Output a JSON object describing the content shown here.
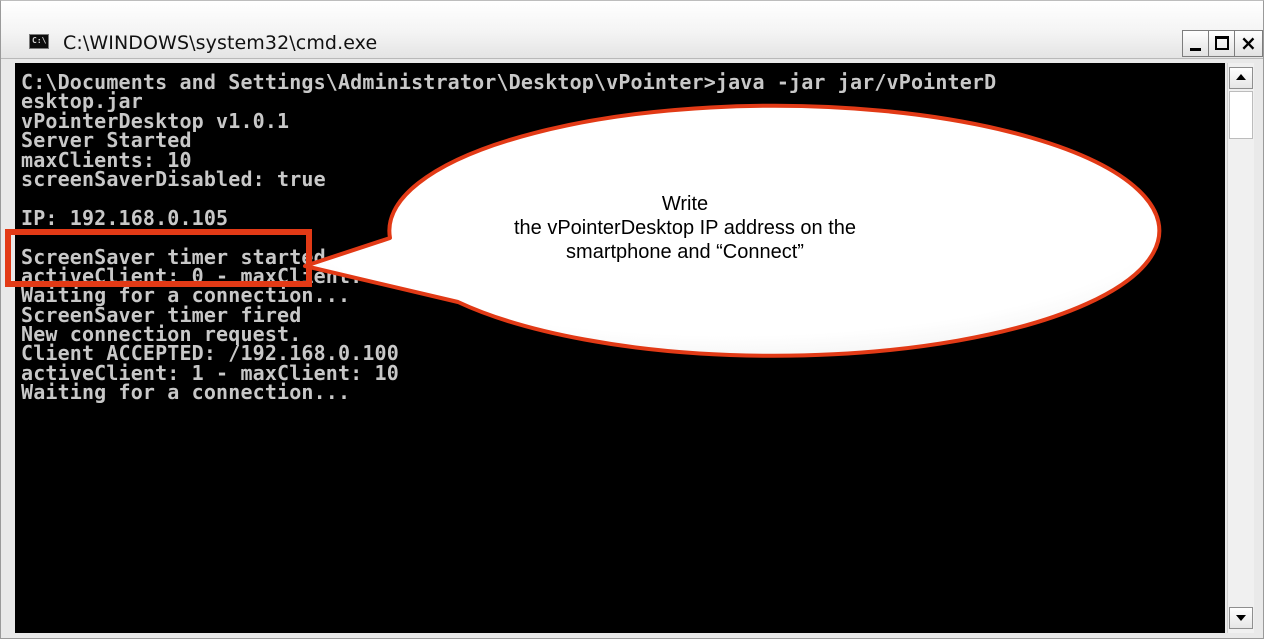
{
  "window": {
    "title": "C:\\WINDOWS\\system32\\cmd.exe",
    "icon_label": "C:\\",
    "controls": {
      "minimize": "_",
      "maximize": "□",
      "close": "×"
    }
  },
  "console": {
    "lines": [
      "C:\\Documents and Settings\\Administrator\\Desktop\\vPointer>java -jar jar/vPointerD",
      "esktop.jar",
      "vPointerDesktop v1.0.1",
      "Server Started",
      "maxClients: 10",
      "screenSaverDisabled: true",
      "",
      "IP: 192.168.0.105",
      "",
      "ScreenSaver timer started. Period",
      "activeClient: 0 - maxClient: 10",
      "Waiting for a connection...",
      "ScreenSaver timer fired",
      "New connection request.",
      "Client ACCEPTED: /192.168.0.100",
      "activeClient: 1 - maxClient: 10",
      "Waiting for a connection..."
    ]
  },
  "callout": {
    "line1": "Write",
    "line2": "the vPointerDesktop IP address on the",
    "line3": "smartphone and “Connect”"
  },
  "colors": {
    "highlight": "#e23a16",
    "console_bg": "#000000",
    "console_text": "#c8c8c8"
  }
}
